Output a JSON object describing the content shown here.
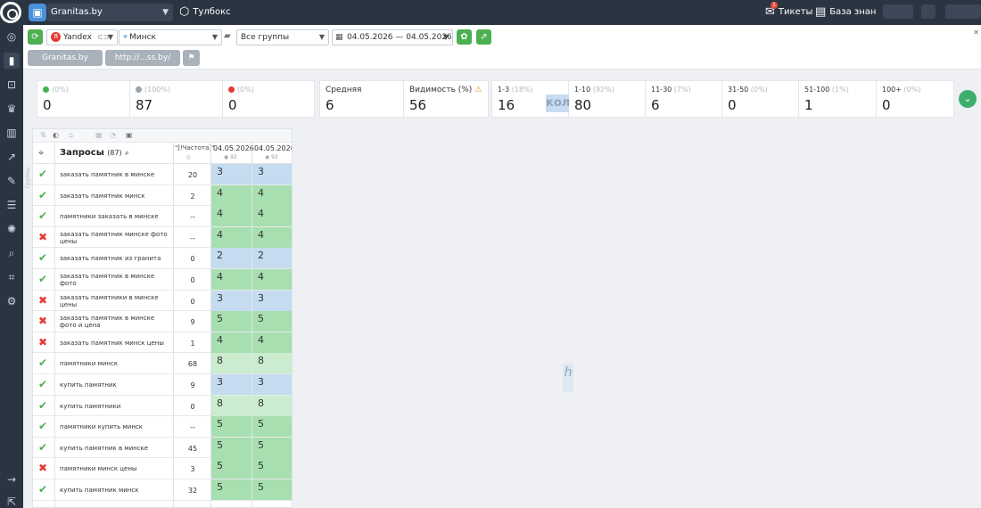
{
  "topbar": {
    "project": "Granitas.by",
    "toolbox": "Тулбокс",
    "tickets": "Тикеты",
    "tickets_badge": "1",
    "kb": "База знан"
  },
  "filters": {
    "engine": "Yandex",
    "region": "Минск",
    "groups": "Все группы",
    "date_range": "04.05.2026 — 04.05.2026"
  },
  "tabs": [
    {
      "label": "Granitas.by"
    },
    {
      "label": "http://...ss.by/"
    }
  ],
  "stats": [
    {
      "pct": "(0%)",
      "value": "0",
      "color": "#4caf50"
    },
    {
      "pct": "(100%)",
      "value": "87",
      "color": "#9aa3ad"
    },
    {
      "pct": "(0%)",
      "value": "0",
      "color": "#e53935"
    },
    {
      "label": "Средняя",
      "value": "6"
    },
    {
      "label": "Видимость (%)",
      "value": "56"
    },
    {
      "label": "1-3",
      "pct": "(18%)",
      "value": "16"
    },
    {
      "label": "1-10",
      "pct": "(92%)",
      "value": "80"
    },
    {
      "label": "11-30",
      "pct": "(7%)",
      "value": "6"
    },
    {
      "label": "31-50",
      "pct": "(0%)",
      "value": "0"
    },
    {
      "label": "51-100",
      "pct": "(1%)",
      "value": "1"
    },
    {
      "label": "100+",
      "pct": "(0%)",
      "value": "0"
    }
  ],
  "overlay": {
    "ghost1": "кол",
    "ghost2": "h"
  },
  "table": {
    "title": "Запросы",
    "count": "(87)",
    "freq_header": "\"[!Частота]\"",
    "freq_sub": "0",
    "side_label": "Группы",
    "dates": [
      {
        "date": "04.05.2026",
        "sub": "92"
      },
      {
        "date": "04.05.2026",
        "sub": "92"
      }
    ],
    "colors": {
      "blue": "#c5dcf0",
      "green": "#a8dfb1",
      "lightgreen": "#cbeccf"
    },
    "rows": [
      {
        "ok": true,
        "keyword": "заказать памятник в минске",
        "freq": "20",
        "pos1": "3",
        "pos2": "3",
        "tone": "blue"
      },
      {
        "ok": true,
        "keyword": "заказать памятник минск",
        "freq": "2",
        "pos1": "4",
        "pos2": "4",
        "tone": "green"
      },
      {
        "ok": true,
        "keyword": "памятники заказать в минске",
        "freq": "--",
        "pos1": "4",
        "pos2": "4",
        "tone": "green"
      },
      {
        "ok": false,
        "keyword": "заказать памятник минске фото цены",
        "freq": "--",
        "pos1": "4",
        "pos2": "4",
        "tone": "green"
      },
      {
        "ok": true,
        "keyword": "заказать памятник из гранита",
        "freq": "0",
        "pos1": "2",
        "pos2": "2",
        "tone": "blue"
      },
      {
        "ok": true,
        "keyword": "заказать памятник в минске фото",
        "freq": "0",
        "pos1": "4",
        "pos2": "4",
        "tone": "green"
      },
      {
        "ok": false,
        "keyword": "заказать памятники в минске цены",
        "freq": "0",
        "pos1": "3",
        "pos2": "3",
        "tone": "blue"
      },
      {
        "ok": false,
        "keyword": "заказать памятник в минске фото и цена",
        "freq": "9",
        "pos1": "5",
        "pos2": "5",
        "tone": "green"
      },
      {
        "ok": false,
        "keyword": "заказать памятник минск цены",
        "freq": "1",
        "pos1": "4",
        "pos2": "4",
        "tone": "green"
      },
      {
        "ok": true,
        "keyword": "памятники минск",
        "freq": "68",
        "pos1": "8",
        "pos2": "8",
        "tone": "lightgreen"
      },
      {
        "ok": true,
        "keyword": "купить памятник",
        "freq": "9",
        "pos1": "3",
        "pos2": "3",
        "tone": "blue"
      },
      {
        "ok": true,
        "keyword": "купить памятники",
        "freq": "0",
        "pos1": "8",
        "pos2": "8",
        "tone": "lightgreen"
      },
      {
        "ok": true,
        "keyword": "памятники купить минск",
        "freq": "--",
        "pos1": "5",
        "pos2": "5",
        "tone": "green"
      },
      {
        "ok": true,
        "keyword": "купить памятник в минске",
        "freq": "45",
        "pos1": "5",
        "pos2": "5",
        "tone": "green"
      },
      {
        "ok": false,
        "keyword": "памятники минск цены",
        "freq": "3",
        "pos1": "5",
        "pos2": "5",
        "tone": "green"
      },
      {
        "ok": true,
        "keyword": "купить памятник минск",
        "freq": "32",
        "pos1": "5",
        "pos2": "5",
        "tone": "green"
      }
    ]
  }
}
